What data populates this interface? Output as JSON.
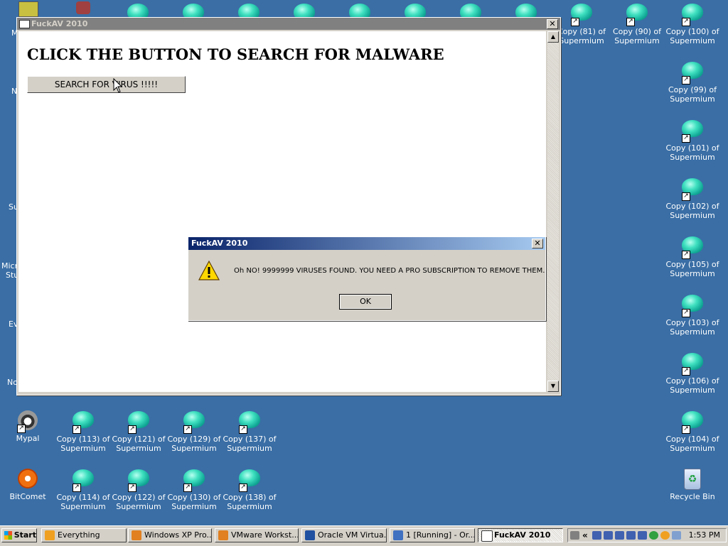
{
  "desktop": {
    "right_icons": [
      {
        "label": "Copy (81) of Supermium"
      },
      {
        "label": "Copy (90) of Supermium"
      },
      {
        "label": "Copy (100) of Supermium"
      },
      {
        "label": "Copy (99) of Supermium"
      },
      {
        "label": "Copy (101) of Supermium"
      },
      {
        "label": "Copy (102) of Supermium"
      },
      {
        "label": "Copy (105) of Supermium"
      },
      {
        "label": "Copy (103) of Supermium"
      },
      {
        "label": "Copy (106) of Supermium"
      },
      {
        "label": "Copy (104) of Supermium"
      },
      {
        "label": "Recycle Bin"
      }
    ],
    "bottom_icons": [
      {
        "label": "Mypal"
      },
      {
        "label": "Copy (113) of Supermium"
      },
      {
        "label": "Copy (121) of Supermium"
      },
      {
        "label": "Copy (129) of Supermium"
      },
      {
        "label": "Copy (137) of Supermium"
      },
      {
        "label": "BitComet"
      },
      {
        "label": "Copy (114) of Supermium"
      },
      {
        "label": "Copy (122) of Supermium"
      },
      {
        "label": "Copy (130) of Supermium"
      },
      {
        "label": "Copy (138) of Supermium"
      }
    ],
    "left_partial": [
      "M",
      "N",
      "Su",
      "Micro",
      "Stu",
      "Ev",
      "No"
    ]
  },
  "main_window": {
    "title": "FuckAV 2010",
    "heading": "CLICK THE BUTTON TO SEARCH FOR MALWARE",
    "search_button": "SEARCH FOR VIRUS !!!!!",
    "close_label": "✕"
  },
  "dialog": {
    "title": "FuckAV 2010",
    "message": "Oh NO! 9999999 VIRUSES FOUND. YOU NEED A PRO SUBSCRIPTION TO REMOVE THEM.",
    "ok_label": "OK",
    "close_label": "✕"
  },
  "taskbar": {
    "start_label": "Start",
    "tasks": [
      {
        "label": "Everything",
        "color": "#f0a020"
      },
      {
        "label": "Windows XP Pro...",
        "color": "#e08020"
      },
      {
        "label": "VMware Workst...",
        "color": "#e08020"
      },
      {
        "label": "Oracle VM Virtua...",
        "color": "#2050a0"
      },
      {
        "label": "1 [Running] - Or...",
        "color": "#4070c0"
      },
      {
        "label": "FuckAV 2010",
        "color": "#ffffff"
      }
    ],
    "clock": "1:53 PM",
    "tray_chevron": "«"
  }
}
